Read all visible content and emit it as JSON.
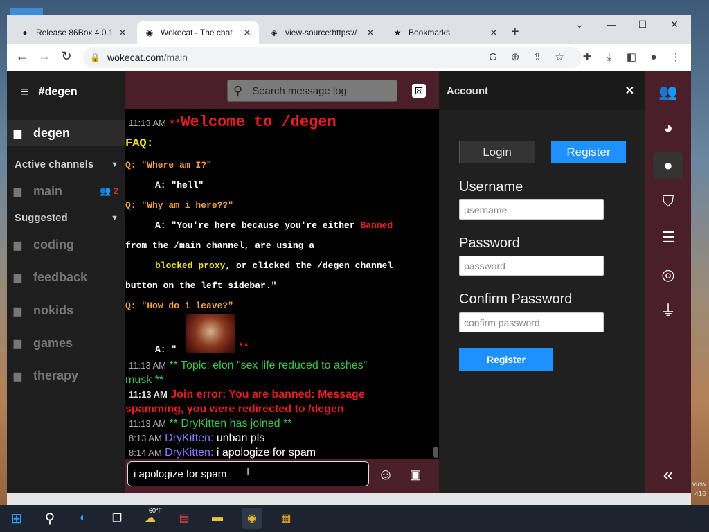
{
  "browser": {
    "tabs": [
      {
        "title": "Release 86Box 4.0.1",
        "icon": "github-icon",
        "active": false
      },
      {
        "title": "Wokecat - The chat",
        "icon": "wokecat-icon",
        "active": true
      },
      {
        "title": "view-source:https://",
        "icon": "cat-icon",
        "active": false
      },
      {
        "title": "Bookmarks",
        "icon": "star-icon",
        "active": false
      }
    ],
    "url_host": "wokecat.com",
    "url_path": "/main"
  },
  "sidebar": {
    "header": "#degen",
    "current_channel": "degen",
    "active_channels_label": "Active channels",
    "active_channels": [
      {
        "name": "main",
        "count": "2"
      }
    ],
    "suggested_label": "Suggested",
    "suggested": [
      "coding",
      "feedback",
      "nokids",
      "games",
      "therapy"
    ]
  },
  "search": {
    "placeholder": "Search message log"
  },
  "log": {
    "welcome_time": "11:13 AM",
    "welcome_prefix": "**",
    "welcome_text": "Welcome to /degen",
    "faq": "FAQ:",
    "q1": "Q: \"Where am I?\"",
    "a1": "A: \"hell\"",
    "q2": "Q: \"Why am i here??\"",
    "a2_part1": "A: \"You're here because you're either ",
    "a2_banned": "Banned",
    "a2_line2": "from the /main channel, are using a",
    "a2_proxy": "blocked proxy",
    "a2_line3_rest": ", or clicked the /degen channel",
    "a2_line4": "button on the left sidebar.\"",
    "q3": "Q: \"How do i leave?\"",
    "a3_prefix": "A: \"",
    "a3_suffix": "**",
    "topic_time": "11:13 AM",
    "topic_line1": "** Topic: elon \"sex life reduced to ashes\"",
    "topic_line2": "musk **",
    "err_time": "11:13 AM",
    "err_line1": "Join error: You are banned: Message",
    "err_line2": "spamming, you were redirected to /degen",
    "join_time": "11:13 AM",
    "join_text": "** DryKitten has joined **",
    "m1_time": "8:13 AM",
    "m1_user": "DryKitten:",
    "m1_text": "unban pls",
    "m2_time": "8:14 AM",
    "m2_user": "DryKitten:",
    "m2_text": "i apologize for spam"
  },
  "composer": {
    "value": "i apologize for spam"
  },
  "account": {
    "title": "Account",
    "login_label": "Login",
    "register_tab_label": "Register",
    "username_label": "Username",
    "username_placeholder": "username",
    "password_label": "Password",
    "password_placeholder": "password",
    "confirm_label": "Confirm Password",
    "confirm_placeholder": "confirm password",
    "register_button": "Register"
  },
  "taskbar": {
    "weather": "60°F"
  },
  "colors": {
    "accent_blue": "#1e90ff",
    "header_maroon": "#4a1f2a",
    "error_red": "#e62020",
    "system_green": "#3cc84a",
    "faq_yellow": "#f0e020",
    "question_orange": "#f0a040",
    "username_purple": "#8a7cff"
  }
}
